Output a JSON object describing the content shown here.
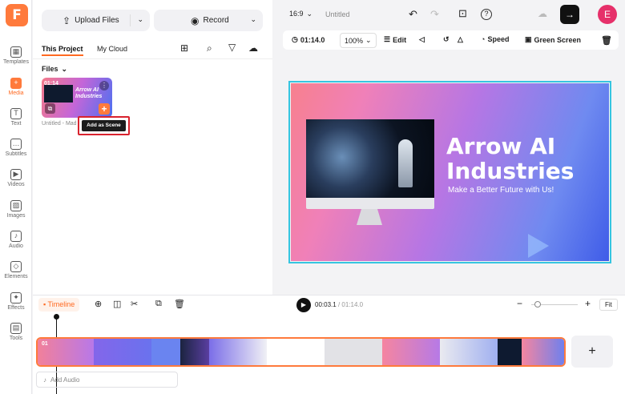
{
  "rail": {
    "items": [
      {
        "label": "Templates",
        "glyph": "▦"
      },
      {
        "label": "Media",
        "glyph": "+"
      },
      {
        "label": "Text",
        "glyph": "T"
      },
      {
        "label": "Subtitles",
        "glyph": "…"
      },
      {
        "label": "Videos",
        "glyph": "▶"
      },
      {
        "label": "Images",
        "glyph": "▨"
      },
      {
        "label": "Audio",
        "glyph": "♪"
      },
      {
        "label": "Elements",
        "glyph": "◇"
      },
      {
        "label": "Effects",
        "glyph": "✦"
      },
      {
        "label": "Tools",
        "glyph": "▤"
      }
    ],
    "active": "Media",
    "accent": "#ff7a3c"
  },
  "panel": {
    "upload_label": "Upload Files",
    "record_label": "Record",
    "tabs": [
      {
        "label": "This Project"
      },
      {
        "label": "My Cloud"
      }
    ],
    "files_label": "Files",
    "media_item": {
      "duration": "01:14",
      "thumb_title": "Arrow AI Industries",
      "name": "Untitled - Mad",
      "tooltip": "Add as Scene"
    }
  },
  "topbar": {
    "ratio": "16:9",
    "title": "Untitled",
    "avatar_letter": "E"
  },
  "toolbar": {
    "duration": "01:14.0",
    "zoom": "100%",
    "edit_label": "Edit",
    "speed_label": "Speed",
    "green_screen_label": "Green Screen"
  },
  "canvas": {
    "title_line1": "Arrow AI",
    "title_line2": "Industries",
    "subtitle": "Make a Better Future with Us!"
  },
  "timeline": {
    "label": "Timeline",
    "current_time": "00:03.1",
    "total_time": "01:14.0",
    "fit_label": "Fit",
    "clip_index": "01",
    "add_audio_label": "Add Audio",
    "add_scene_glyph": "+"
  }
}
